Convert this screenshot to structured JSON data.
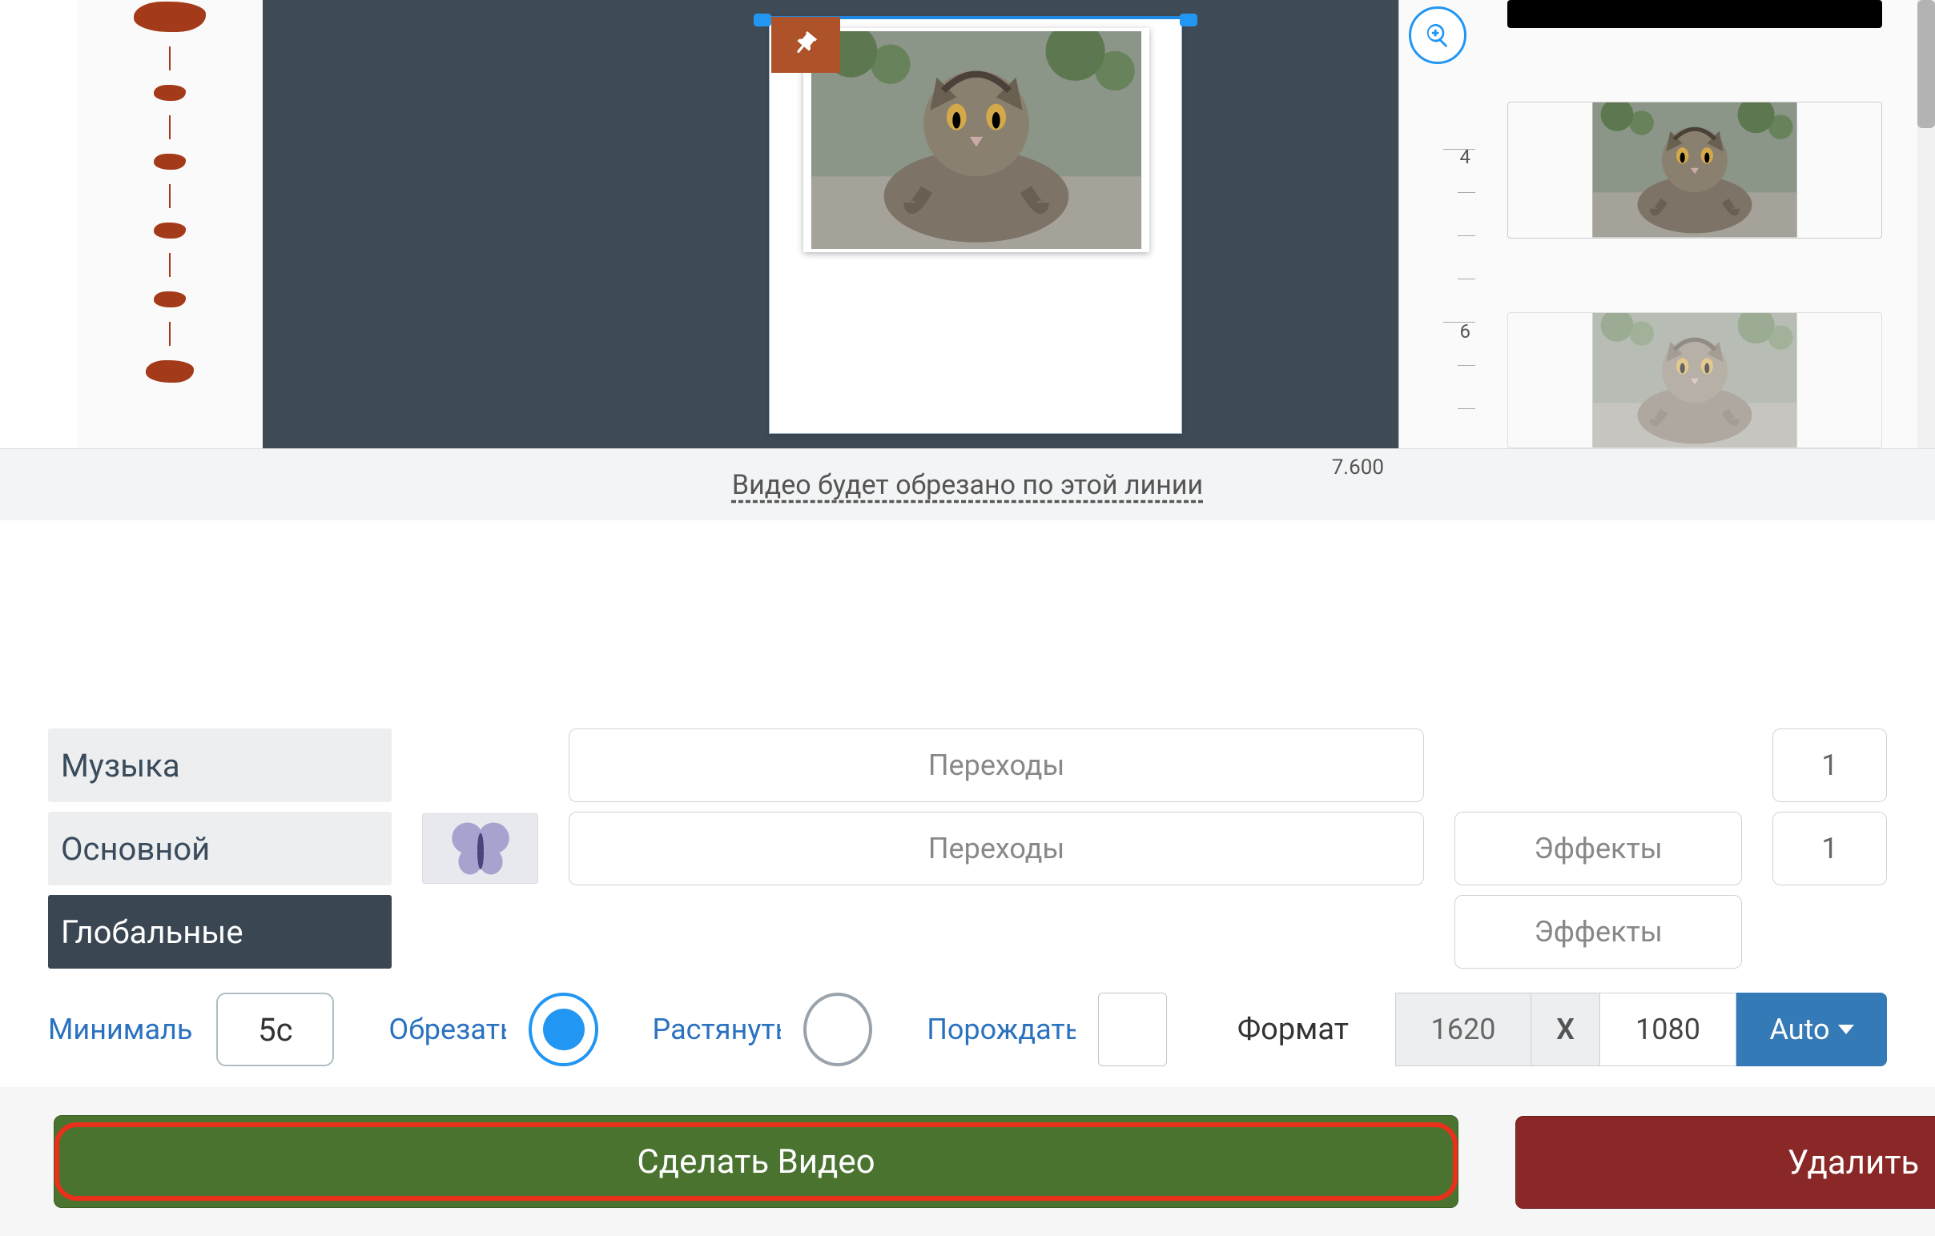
{
  "colors": {
    "accent_blue": "#2196f3",
    "canvas_bg": "#3e4b57",
    "make_green": "#4a7330",
    "delete_red": "#8a2828",
    "highlight": "#e9301b"
  },
  "ruler": {
    "ticks": [
      "4",
      "6"
    ],
    "trim_time": "7.600"
  },
  "trim_notice": "Видео будет обрезано по этой линии",
  "layers": {
    "music": {
      "label": "Музыка",
      "transitions_btn": "Переходы",
      "count": "1"
    },
    "main": {
      "label": "Основной",
      "transitions_btn": "Переходы",
      "effects_btn": "Эффекты",
      "count": "1"
    },
    "global": {
      "label": "Глобальные",
      "effects_btn": "Эффекты"
    }
  },
  "controls": {
    "minimal_label": "Минималь",
    "minimal_value": "5с",
    "crop_label": "Обрезать",
    "stretch_label": "Растянуть",
    "spawn_label": "Порождать",
    "crop_selected": true,
    "format_label": "Формат",
    "format_w": "1620",
    "format_x": "X",
    "format_h": "1080",
    "auto_label": "Auto"
  },
  "footer": {
    "make_label": "Сделать Видео",
    "delete_label": "Удалить"
  },
  "icons": {
    "pin": "pin-icon",
    "zoom": "zoom-in-icon"
  }
}
